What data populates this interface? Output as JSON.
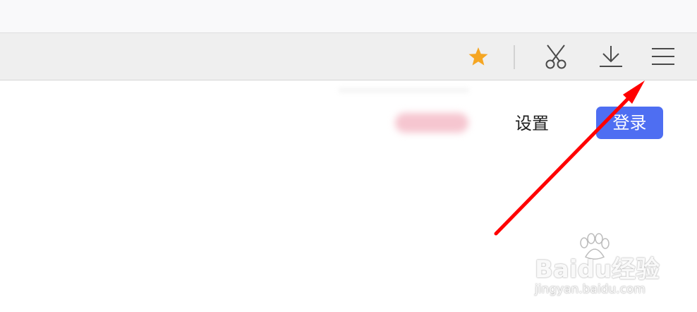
{
  "toolbar": {
    "icons": [
      "star-icon",
      "scissors-icon",
      "download-icon",
      "menu-icon"
    ],
    "star_color": "#f5a623",
    "icon_color": "#4a4a4a"
  },
  "page": {
    "settings_label": "设置",
    "login_label": "登录",
    "login_color": "#4e6ef2"
  },
  "annotation": {
    "arrow_color": "#ff0000"
  },
  "watermark": {
    "brand": "Baidu经验",
    "url": "jingyan.baidu.com"
  }
}
